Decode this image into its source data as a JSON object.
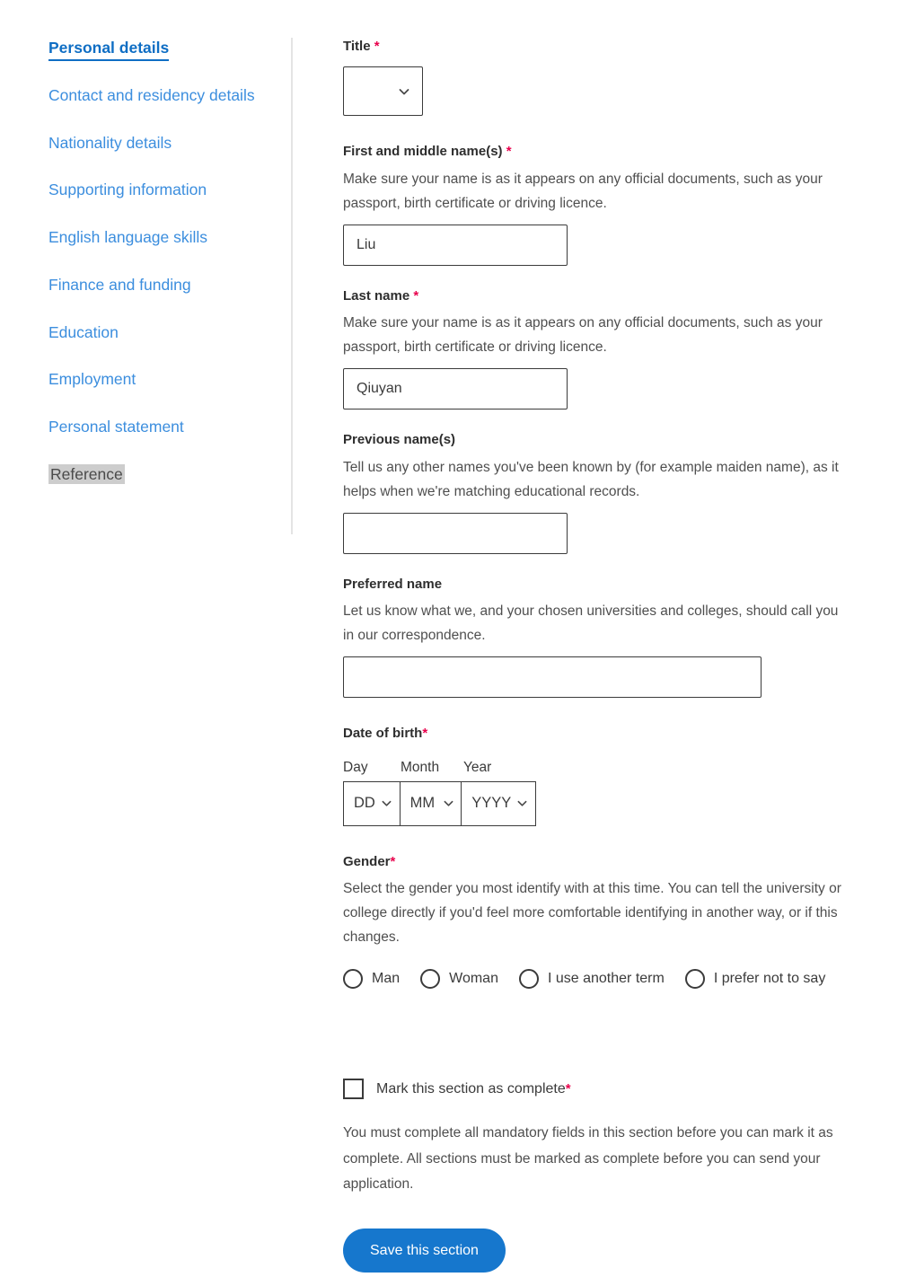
{
  "sidebar": {
    "items": [
      {
        "label": "Personal details",
        "state": "active"
      },
      {
        "label": "Contact and residency details",
        "state": "link"
      },
      {
        "label": "Nationality details",
        "state": "link"
      },
      {
        "label": "Supporting information",
        "state": "link"
      },
      {
        "label": "English language skills",
        "state": "link"
      },
      {
        "label": "Finance and funding",
        "state": "link"
      },
      {
        "label": "Education",
        "state": "link"
      },
      {
        "label": "Employment",
        "state": "link"
      },
      {
        "label": "Personal statement",
        "state": "link"
      },
      {
        "label": "Reference",
        "state": "current"
      }
    ]
  },
  "form": {
    "required_marker": "*",
    "title": {
      "label": "Title",
      "value": "",
      "placeholder": ""
    },
    "first_name": {
      "label": "First and middle name(s)",
      "hint": "Make sure your name is as it appears on any official documents, such as your passport, birth certificate or driving licence.",
      "value": "Liu"
    },
    "last_name": {
      "label": "Last name",
      "hint": "Make sure your name is as it appears on any official documents, such as your passport, birth certificate or driving licence.",
      "value": "Qiuyan"
    },
    "previous_names": {
      "label": "Previous name(s)",
      "hint": "Tell us any other names you've been known by (for example maiden name), as it helps when we're matching educational records.",
      "value": ""
    },
    "preferred_name": {
      "label": "Preferred name",
      "hint": "Let us know what we, and your chosen universities and colleges, should call you in our correspondence.",
      "value": ""
    },
    "date_of_birth": {
      "label": "Date of birth",
      "day_label": "Day",
      "month_label": "Month",
      "year_label": "Year",
      "day_value": "DD",
      "month_value": "MM",
      "year_value": "YYYY"
    },
    "gender": {
      "label": "Gender",
      "hint": "Select the gender you most identify with at this time. You can tell the university or college directly if you'd feel more comfortable identifying in another way, or if this changes.",
      "options": [
        {
          "label": "Man",
          "selected": false
        },
        {
          "label": "Woman",
          "selected": false
        },
        {
          "label": "I use another term",
          "selected": false
        },
        {
          "label": "I prefer not to say",
          "selected": false
        }
      ]
    },
    "mark_complete": {
      "label": "Mark this section as complete",
      "checked": false
    },
    "footer_note": "You must complete all mandatory fields in this section before you can mark it as complete. All sections must be marked as complete before you can send your application.",
    "save_button": "Save this section"
  },
  "colors": {
    "link_blue": "#3c8ede",
    "active_blue": "#0f6ec4",
    "button_blue": "#1677cd",
    "required_red": "#e8004c",
    "current_bg": "#cdcdcd"
  }
}
